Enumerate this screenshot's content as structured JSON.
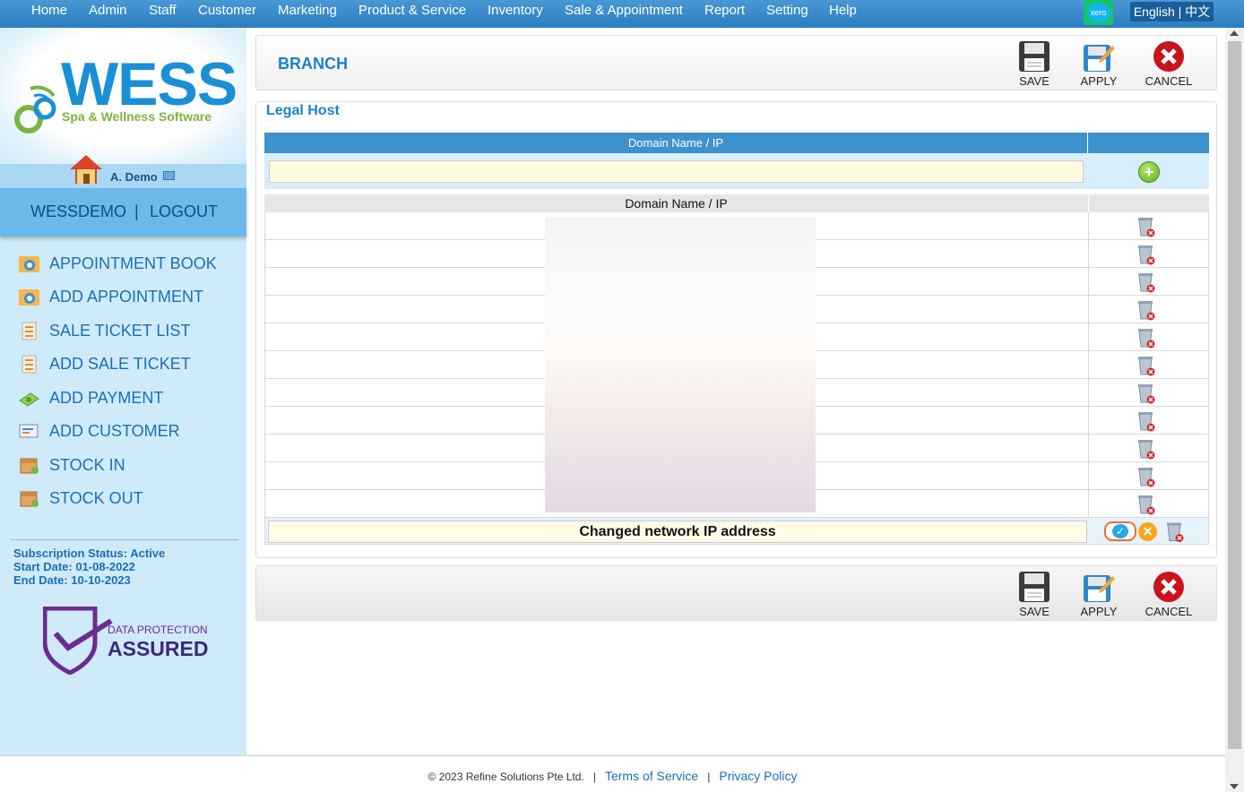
{
  "topnav": {
    "items": [
      "Home",
      "Admin",
      "Staff",
      "Customer",
      "Marketing",
      "Product & Service",
      "Inventory",
      "Sale & Appointment",
      "Report",
      "Setting",
      "Help"
    ],
    "xero": "xero",
    "language": "English | 中文"
  },
  "sidebar": {
    "logo_text": "WESS",
    "logo_tagline": "Spa & Wellness Software",
    "user_name": "A. Demo",
    "account": "WESSDEMO",
    "separator": "|",
    "logout": "LOGOUT",
    "menu": [
      {
        "label": "APPOINTMENT BOOK",
        "icon": "calendar-icon"
      },
      {
        "label": "ADD APPOINTMENT",
        "icon": "calendar-add-icon"
      },
      {
        "label": "SALE TICKET LIST",
        "icon": "ticket-list-icon"
      },
      {
        "label": "ADD SALE TICKET",
        "icon": "ticket-add-icon"
      },
      {
        "label": "ADD PAYMENT",
        "icon": "money-icon"
      },
      {
        "label": "ADD CUSTOMER",
        "icon": "customer-card-icon"
      },
      {
        "label": "STOCK IN",
        "icon": "box-in-icon"
      },
      {
        "label": "STOCK OUT",
        "icon": "box-out-icon"
      }
    ],
    "subscription": {
      "status": "Subscription Status: Active",
      "start": "Start Date: 01-08-2022",
      "end": "End Date: 10-10-2023"
    },
    "badge": {
      "line1": "DATA PROTECTION",
      "line2": "ASSURED"
    }
  },
  "header": {
    "title": "BRANCH",
    "save": "SAVE",
    "apply": "APPLY",
    "cancel": "CANCEL"
  },
  "legal_host": {
    "title": "Legal Host",
    "column_header": "Domain Name / IP",
    "new_value": "",
    "list_header": "Domain Name / IP",
    "row_count": 11,
    "editing_value": "Changed network IP address"
  },
  "footer_toolbar": {
    "save": "SAVE",
    "apply": "APPLY",
    "cancel": "CANCEL"
  },
  "footer": {
    "copyright": "© 2023 Refine Solutions Pte Ltd.",
    "sep": "|",
    "terms": "Terms of Service",
    "privacy": "Privacy Policy"
  },
  "colors": {
    "accent": "#1c82c6",
    "nav": "#2b7dc2",
    "sidebar": "#cfeaf9"
  }
}
